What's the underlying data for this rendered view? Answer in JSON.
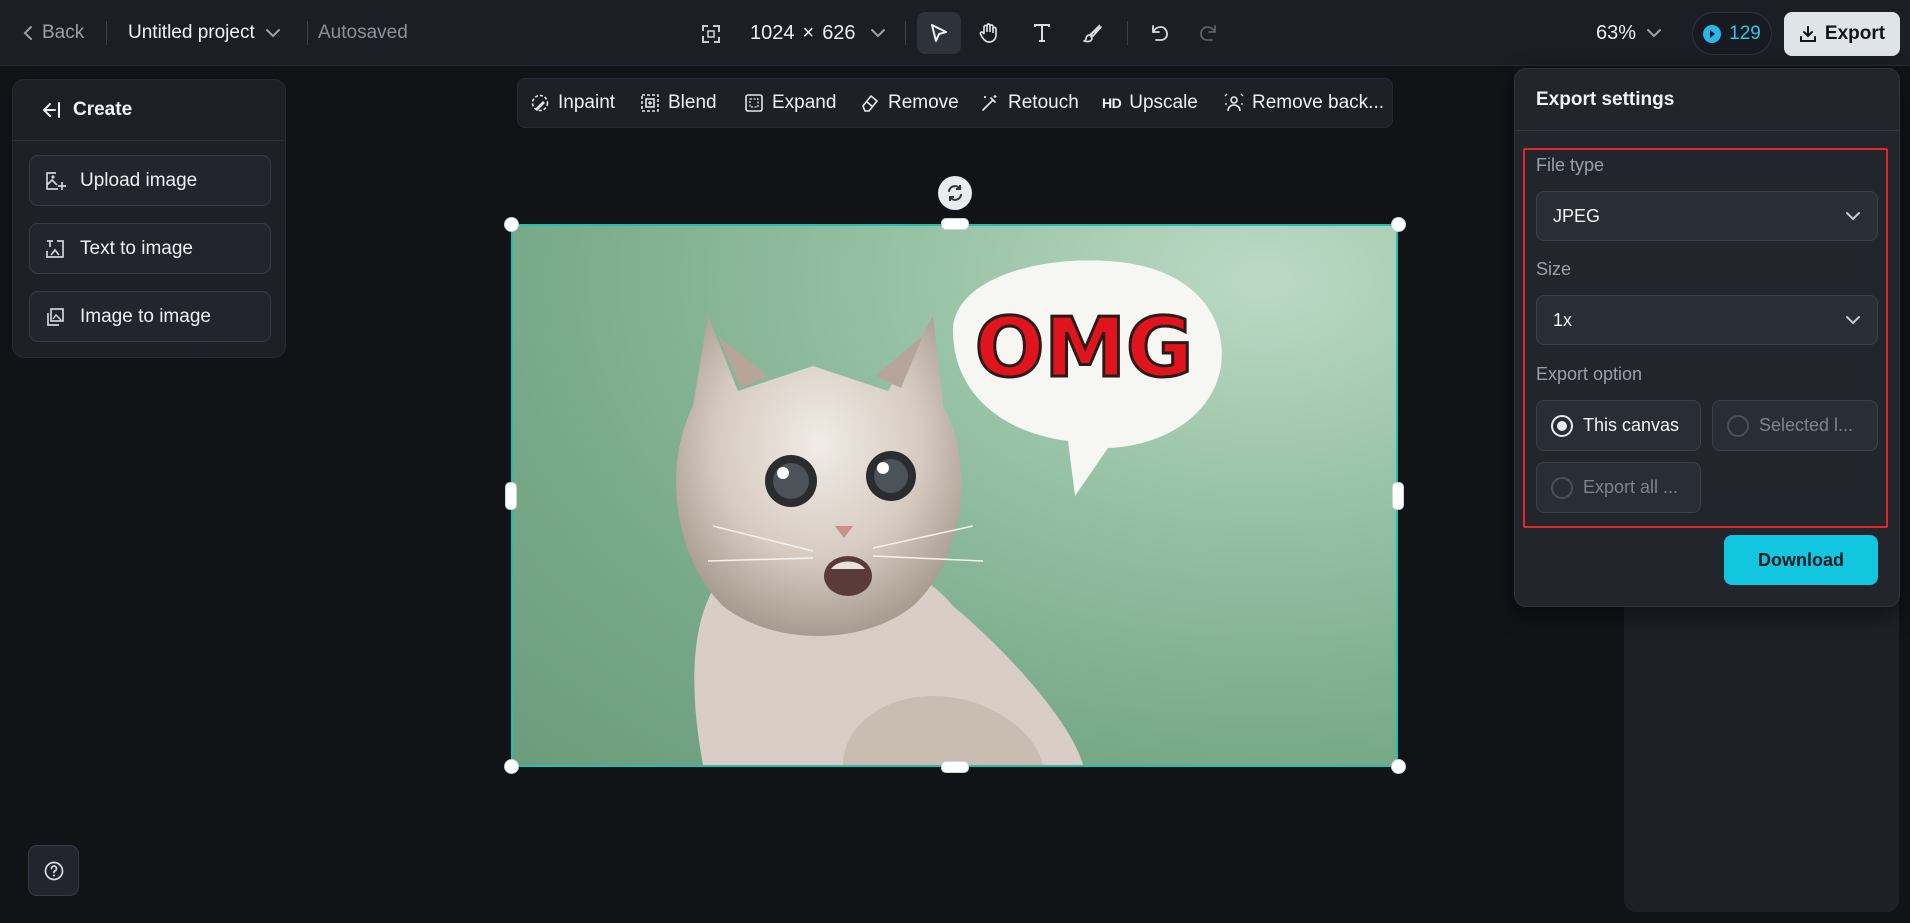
{
  "topbar": {
    "back_label": "Back",
    "project_name": "Untitled project",
    "autosave_status": "Autosaved",
    "canvas_width": "1024",
    "canvas_times": "×",
    "canvas_height": "626",
    "zoom": "63%",
    "credits": "129",
    "export_label": "Export",
    "tools": [
      "select-icon",
      "hand-icon",
      "text-icon",
      "brush-icon",
      "undo-icon",
      "redo-icon"
    ]
  },
  "create_panel": {
    "title": "Create",
    "items": [
      {
        "label": "Upload image",
        "icon": "upload-image-icon"
      },
      {
        "label": "Text to image",
        "icon": "text-to-image-icon"
      },
      {
        "label": "Image to image",
        "icon": "image-to-image-icon"
      }
    ]
  },
  "edit_toolbar": {
    "items": [
      {
        "label": "Inpaint",
        "icon": "inpaint-icon"
      },
      {
        "label": "Blend",
        "icon": "blend-icon"
      },
      {
        "label": "Expand",
        "icon": "expand-icon"
      },
      {
        "label": "Remove",
        "icon": "eraser-icon"
      },
      {
        "label": "Retouch",
        "icon": "magic-wand-icon"
      },
      {
        "label": "Upscale",
        "icon_text": "HD"
      },
      {
        "label": "Remove back...",
        "icon": "remove-background-icon"
      }
    ]
  },
  "canvas": {
    "image_text": "OMG",
    "image_description_icon": "cat-photo"
  },
  "export_settings": {
    "title": "Export settings",
    "file_type_label": "File type",
    "file_type_value": "JPEG",
    "size_label": "Size",
    "size_value": "1x",
    "export_option_label": "Export option",
    "options": [
      {
        "label": "This canvas",
        "selected": true
      },
      {
        "label": "Selected l...",
        "selected": false
      },
      {
        "label": "Export all ...",
        "selected": false
      }
    ],
    "download_label": "Download"
  },
  "colors": {
    "accent": "#12c6e0",
    "selection": "#20c0b4",
    "highlight": "#e0262b",
    "background": "#111317"
  }
}
